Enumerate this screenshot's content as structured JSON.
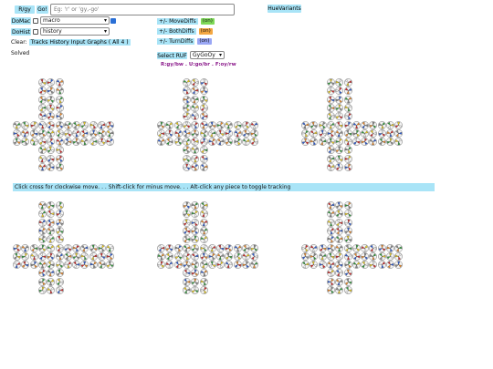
{
  "toolbar": {
    "rgy_label": "R/gy",
    "go_label": "Go!",
    "move_placeholder": "Eg: 'r' or 'gy,-go'",
    "huevariants_label": "HueVariants",
    "domac_label": "DoMac",
    "macro_value": "macro",
    "dohist_label": "DoHist",
    "history_value": "history",
    "clear_label": "Clear:",
    "clear_links": [
      "Tracks",
      "History",
      "Input",
      "Graphs"
    ],
    "all_label": "( All 4 )",
    "status": "Solved",
    "move_diffs_label": "+/- MoveDiffs",
    "move_diffs_state": "(on)",
    "both_diffs_label": "+/- BothDiffs",
    "both_diffs_state": "(on)",
    "turn_diffs_label": "+/- TurnDiffs",
    "turn_diffs_state": "(on)",
    "select_ruf_label": "Select RUF",
    "ruf_value": "GyGoOy",
    "ruf_mapping": "R:gy/bw . U:go/br . F:oy/rw"
  },
  "instructions": "Click cross for clockwise move. . . Shift-click for minus move. . . Alt-click any piece to toggle tracking",
  "colors": {
    "accent": "#a9e4f7",
    "diff_on_green": "#7ed957",
    "diff_on_orange": "#f4a742",
    "diff_on_blue": "#9aa7f5",
    "ruf_text": "#8b1a8b"
  },
  "puzzles": [
    "puzzle-1",
    "puzzle-2",
    "puzzle-3",
    "puzzle-4",
    "puzzle-5",
    "puzzle-6"
  ]
}
